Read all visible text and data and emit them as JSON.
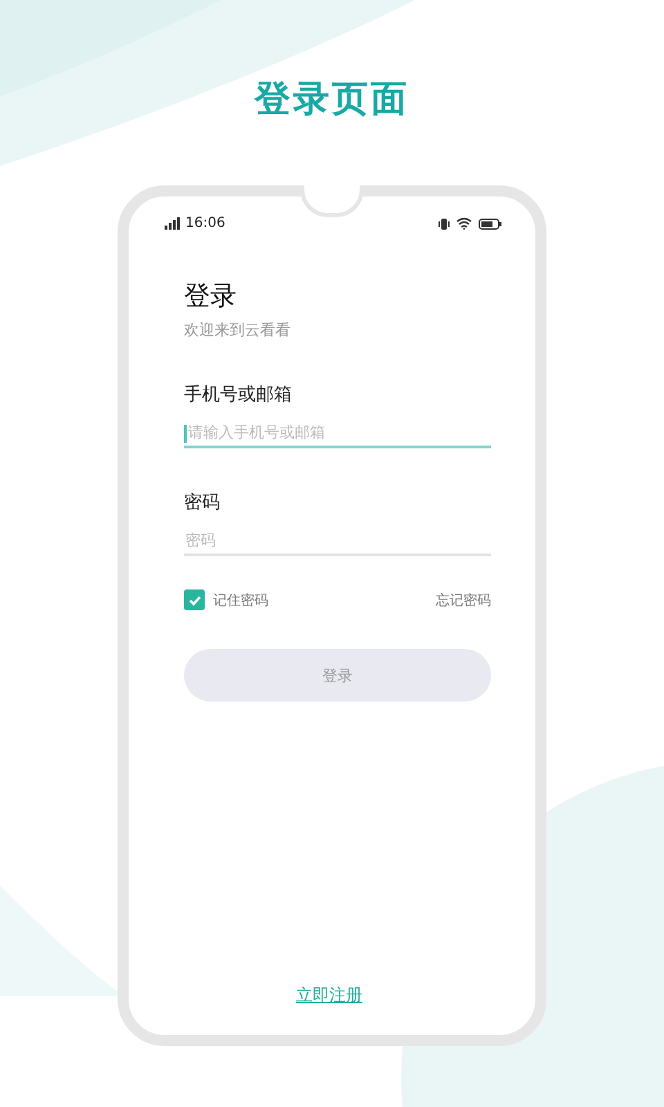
{
  "headline": "登录页面",
  "status_bar": {
    "time": "16:06"
  },
  "login": {
    "title": "登录",
    "subtitle": "欢迎来到云看看",
    "fields": [
      {
        "label": "手机号或邮箱",
        "placeholder": "请输入手机号或邮箱",
        "focused": true
      },
      {
        "label": "密码",
        "placeholder": "密码",
        "focused": false
      }
    ],
    "remember": {
      "label": "记住密码",
      "checked": true
    },
    "forgot": "忘记密码",
    "submit": {
      "label": "登录",
      "disabled": true
    },
    "register": "立即注册"
  }
}
